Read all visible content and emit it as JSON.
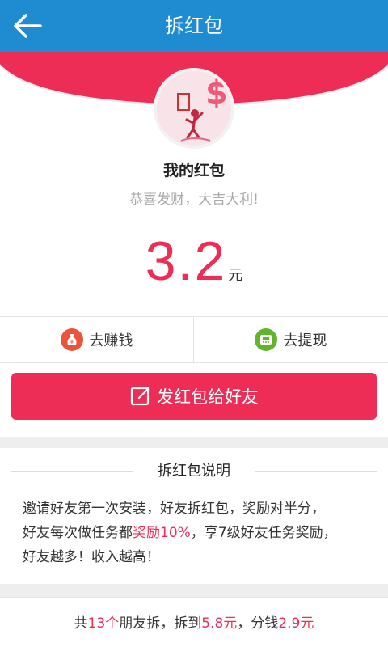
{
  "header": {
    "title": "拆红包",
    "back_icon": "back-arrow-icon"
  },
  "profile": {
    "name": "我的红包",
    "wish": "恭喜发财，大吉大利!"
  },
  "amount": {
    "value": "3.2",
    "unit": "元"
  },
  "actions": [
    {
      "label": "去赚钱",
      "icon": "money-bag-icon",
      "color": "#e8553a"
    },
    {
      "label": "去提现",
      "icon": "phone-icon",
      "color": "#5fb62b"
    }
  ],
  "send_button": {
    "label": "发红包给好友",
    "icon": "share-icon"
  },
  "explain": {
    "title": "拆红包说明",
    "line1": "邀请好友第一次安装，好友拆红包，奖励对半分，",
    "line2_pre": "好友每次做任务都",
    "line2_red": "奖励10%",
    "line2_post": "，享7级好友任务奖励，",
    "line3": "好友越多！收入越高！"
  },
  "footer": {
    "p1": "共",
    "count": "13个",
    "p2": "朋友拆，拆到",
    "got": "5.8元",
    "p3": "，分钱",
    "share": "2.9元"
  },
  "colors": {
    "header": "#1f8bd0",
    "accent": "#ee2d57"
  }
}
